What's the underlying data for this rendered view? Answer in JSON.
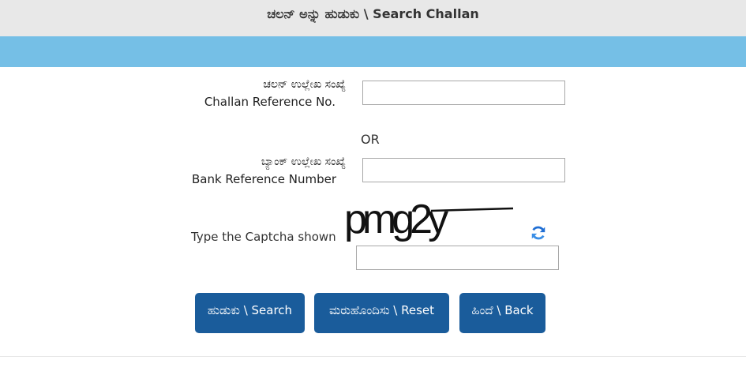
{
  "header": {
    "title": "ಚಲನ್ ಅನ್ನು ಹುಡುಕು \\ Search Challan"
  },
  "form": {
    "challan_ref": {
      "label_kn": "ಚಲನ್ ಉಲ್ಲೇಖ ಸಂಖ್ಯೆ",
      "label_en": "Challan Reference No.",
      "value": ""
    },
    "or_text": "OR",
    "bank_ref": {
      "label_kn": "ಬ್ಯಾಂಕ್ ಉಲ್ಲೇಖ ಸಂಖ್ಯೆ",
      "label_en": "Bank Reference Number",
      "value": ""
    },
    "captcha": {
      "label": "Type the Captcha shown",
      "image_text": "pmg2y",
      "value": "",
      "refresh_icon": "refresh-icon"
    }
  },
  "buttons": {
    "search": "ಹುಡುಕು \\ Search",
    "reset": "ಮರುಹೊಂದಿಸು \\ Reset",
    "back": "ಹಿಂದೆ \\ Back"
  },
  "colors": {
    "header_bg": "#e8e8e8",
    "banner": "#75bfe6",
    "button": "#1a5c9b"
  }
}
